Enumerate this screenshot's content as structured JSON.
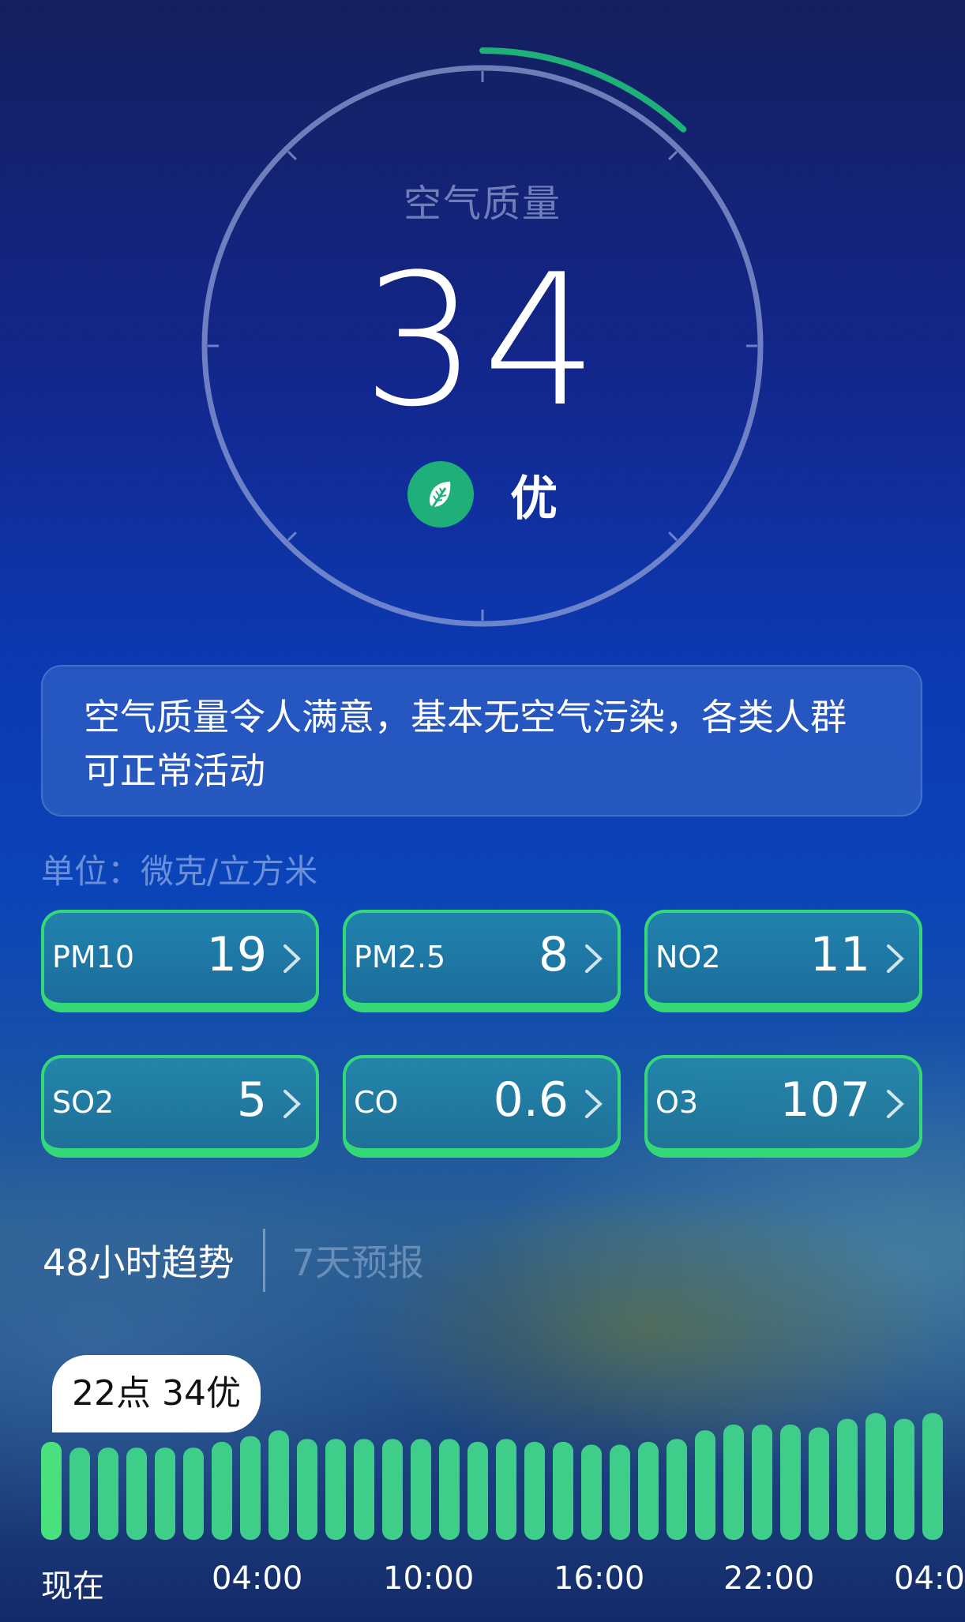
{
  "aqi": {
    "title": "空气质量",
    "value": "34",
    "level": "优",
    "progress": 0.34,
    "accent_color": "#1fb07a"
  },
  "advice": "空气质量令人满意，基本无空气污染，各类人群可正常活动",
  "unit_label": "单位：微克/立方米",
  "pollutants": [
    {
      "name": "PM10",
      "value": "19"
    },
    {
      "name": "PM2.5",
      "value": "8"
    },
    {
      "name": "NO2",
      "value": "11"
    },
    {
      "name": "SO2",
      "value": "5"
    },
    {
      "name": "CO",
      "value": "0.6"
    },
    {
      "name": "O3",
      "value": "107"
    }
  ],
  "trend_tabs": {
    "active": "48小时趋势",
    "inactive": "7天预报"
  },
  "tooltip": "22点 34优",
  "hourly_trend": {
    "aqi_levels": [
      34,
      32,
      32,
      32,
      32,
      32,
      34,
      36,
      38,
      35,
      35,
      35,
      35,
      35,
      35,
      34,
      35,
      34,
      34,
      33,
      33,
      34,
      35,
      38,
      40,
      40,
      40,
      39,
      42,
      44,
      42,
      44,
      42,
      42
    ],
    "selected_index": 0,
    "x_labels": [
      "现在",
      "04:00",
      "10:00",
      "16:00",
      "22:00",
      "04:00"
    ],
    "bar_color": "#3fce8a",
    "selected_color": "#49e07e"
  },
  "icons": {
    "level_icon": "leaf-icon",
    "card_action": "chevron-right-icon"
  }
}
